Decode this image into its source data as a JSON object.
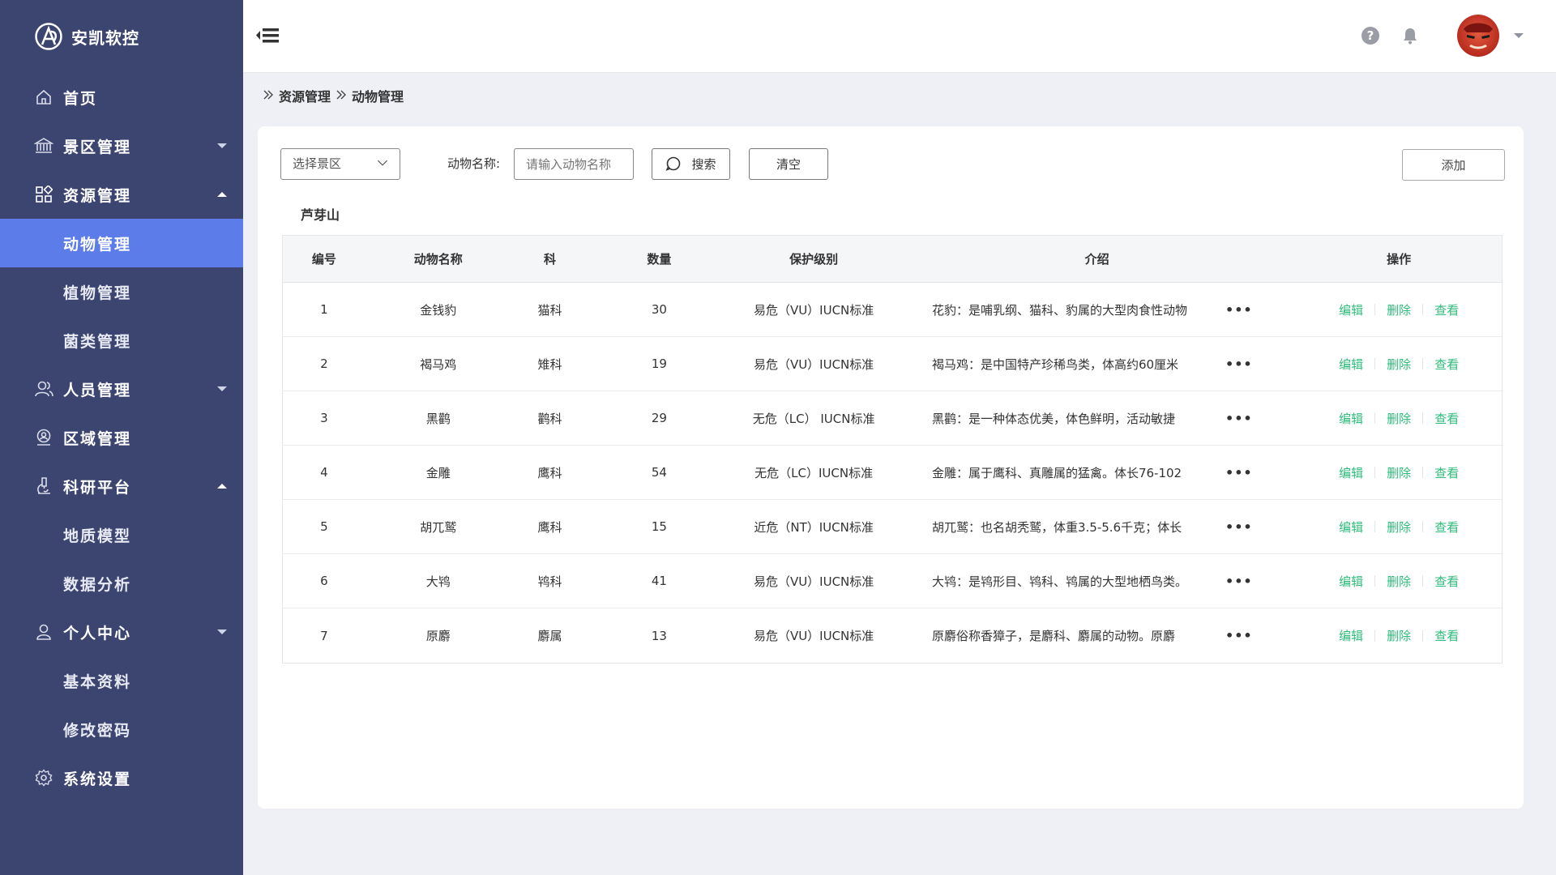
{
  "brand": {
    "name": "安凯软控"
  },
  "sidebar": {
    "items": [
      {
        "label": "首页"
      },
      {
        "label": "景区管理"
      },
      {
        "label": "资源管理"
      },
      {
        "label": "动物管理"
      },
      {
        "label": "植物管理"
      },
      {
        "label": "菌类管理"
      },
      {
        "label": "人员管理"
      },
      {
        "label": "区域管理"
      },
      {
        "label": "科研平台"
      },
      {
        "label": "地质模型"
      },
      {
        "label": "数据分析"
      },
      {
        "label": "个人中心"
      },
      {
        "label": "基本资料"
      },
      {
        "label": "修改密码"
      },
      {
        "label": "系统设置"
      }
    ]
  },
  "header": {
    "help": "?"
  },
  "breadcrumb": {
    "items": [
      "资源管理",
      "动物管理"
    ]
  },
  "toolbar": {
    "select_placeholder": "选择景区",
    "name_label": "动物名称:",
    "name_placeholder": "请输入动物名称",
    "search_label": "搜索",
    "clear_label": "清空",
    "add_label": "添加"
  },
  "area_title": "芦芽山",
  "table": {
    "columns": [
      "编号",
      "动物名称",
      "科",
      "数量",
      "保护级别",
      "介绍",
      "操作"
    ],
    "rows": [
      {
        "id": "1",
        "name": "金钱豹",
        "family": "猫科",
        "qty": "30",
        "level": "易危（VU）IUCN标准",
        "intro": "花豹：是哺乳纲、猫科、豹属的大型肉食性动物"
      },
      {
        "id": "2",
        "name": "褐马鸡",
        "family": "雉科",
        "qty": "19",
        "level": "易危（VU）IUCN标准",
        "intro": "褐马鸡：是中国特产珍稀鸟类，体高约60厘米"
      },
      {
        "id": "3",
        "name": "黑鹳",
        "family": "鹳科",
        "qty": "29",
        "level": "无危（LC） IUCN标准",
        "intro": "黑鹳：是一种体态优美，体色鲜明，活动敏捷"
      },
      {
        "id": "4",
        "name": "金雕",
        "family": "鹰科",
        "qty": "54",
        "level": "无危（LC）IUCN标准",
        "intro": "金雕：属于鹰科、真雕属的猛禽。体长76-102"
      },
      {
        "id": "5",
        "name": "胡兀鹫",
        "family": "鹰科",
        "qty": "15",
        "level": "近危（NT）IUCN标准",
        "intro": "胡兀鹫：也名胡秃鹫，体重3.5-5.6千克；体长"
      },
      {
        "id": "6",
        "name": "大鸨",
        "family": "鸨科",
        "qty": "41",
        "level": "易危（VU）IUCN标准",
        "intro": "大鸨：是鸨形目、鸨科、鸨属的大型地栖鸟类。"
      },
      {
        "id": "7",
        "name": "原麝",
        "family": "麝属",
        "qty": "13",
        "level": "易危（VU）IUCN标准",
        "intro": "原麝俗称香獐子，是麝科、麝属的动物。原麝"
      }
    ],
    "more": "•••",
    "ops": {
      "edit": "编辑",
      "delete": "删除",
      "view": "查看"
    }
  },
  "colors": {
    "sidebar_bg": "#3c4470",
    "active_bg": "#5b7ce9",
    "op_green": "#2ebd7a"
  }
}
